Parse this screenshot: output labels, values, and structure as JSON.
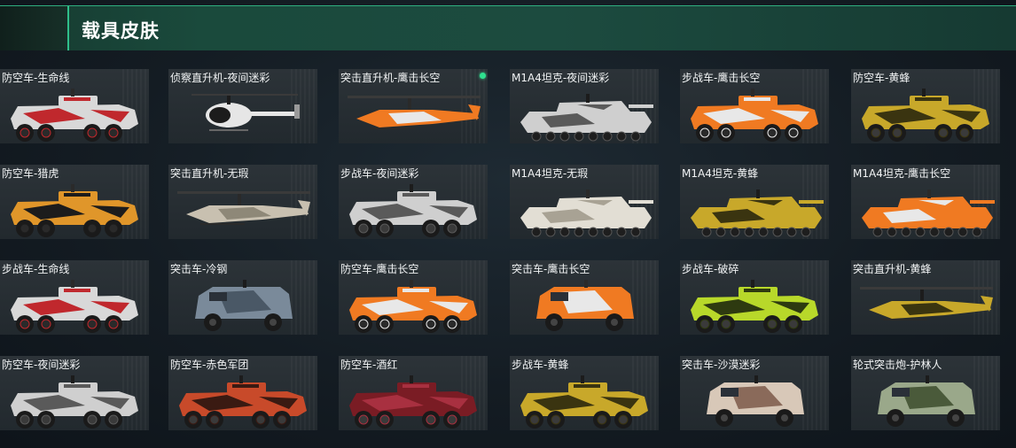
{
  "header": {
    "title": "载具皮肤"
  },
  "colors": {
    "accent": "#2fbf8a",
    "header_bg": "#1a4a3c",
    "card_bg": "#272e33"
  },
  "skins": [
    {
      "label": "防空车-生命线",
      "vehicle": "wheeled",
      "palette": [
        "#d8d8d8",
        "#c0282d",
        "#2a2a2a"
      ]
    },
    {
      "label": "侦察直升机-夜间迷彩",
      "vehicle": "scout-heli",
      "palette": [
        "#e6e6e6",
        "#9a9a9a",
        "#1c1c1c"
      ]
    },
    {
      "label": "突击直升机-鹰击长空",
      "vehicle": "attack-heli",
      "palette": [
        "#f07a22",
        "#e8e8e8",
        "#2a2a2a"
      ],
      "equipped": true
    },
    {
      "label": "M1A4坦克-夜间迷彩",
      "vehicle": "tank",
      "palette": [
        "#cfcfcf",
        "#5a5a5a",
        "#1c1c1c"
      ]
    },
    {
      "label": "步战车-鹰击长空",
      "vehicle": "wheeled",
      "palette": [
        "#f07a22",
        "#e8e8e8",
        "#2a2a2a"
      ]
    },
    {
      "label": "防空车-黄蜂",
      "vehicle": "wheeled",
      "palette": [
        "#c8a82a",
        "#3a3410",
        "#1c1c1c"
      ]
    },
    {
      "label": "防空车-猎虎",
      "vehicle": "wheeled",
      "palette": [
        "#e0962a",
        "#1c1c1c",
        "#2a2a2a"
      ]
    },
    {
      "label": "突击直升机-无瑕",
      "vehicle": "attack-heli",
      "palette": [
        "#c8c0b0",
        "#8e8878",
        "#2a2a2a"
      ]
    },
    {
      "label": "步战车-夜间迷彩",
      "vehicle": "wheeled",
      "palette": [
        "#cfcfcf",
        "#5a5a5a",
        "#1c1c1c"
      ]
    },
    {
      "label": "M1A4坦克-无瑕",
      "vehicle": "tank",
      "palette": [
        "#e2ded4",
        "#a8a294",
        "#2a2a2a"
      ]
    },
    {
      "label": "M1A4坦克-黄蜂",
      "vehicle": "tank",
      "palette": [
        "#c8a82a",
        "#3a3410",
        "#1c1c1c"
      ]
    },
    {
      "label": "M1A4坦克-鹰击长空",
      "vehicle": "tank",
      "palette": [
        "#f07a22",
        "#e8e8e8",
        "#2a2a2a"
      ]
    },
    {
      "label": "步战车-生命线",
      "vehicle": "wheeled",
      "palette": [
        "#d8d8d8",
        "#c0282d",
        "#2a2a2a"
      ]
    },
    {
      "label": "突击车-冷钢",
      "vehicle": "armored-car",
      "palette": [
        "#7a8a9a",
        "#4a5866",
        "#1c1c1c"
      ]
    },
    {
      "label": "防空车-鹰击长空",
      "vehicle": "wheeled",
      "palette": [
        "#f07a22",
        "#e8e8e8",
        "#2a2a2a"
      ]
    },
    {
      "label": "突击车-鹰击长空",
      "vehicle": "armored-car",
      "palette": [
        "#f07a22",
        "#e8e8e8",
        "#2a2a2a"
      ]
    },
    {
      "label": "步战车-破碎",
      "vehicle": "wheeled",
      "palette": [
        "#b8d82a",
        "#2e3a10",
        "#1c1c1c"
      ]
    },
    {
      "label": "突击直升机-黄蜂",
      "vehicle": "attack-heli",
      "palette": [
        "#c8a82a",
        "#3a3410",
        "#1c1c1c"
      ]
    },
    {
      "label": "防空车-夜间迷彩",
      "vehicle": "wheeled",
      "palette": [
        "#cfcfcf",
        "#5a5a5a",
        "#1c1c1c"
      ]
    },
    {
      "label": "防空车-赤色军团",
      "vehicle": "wheeled",
      "palette": [
        "#c84a2a",
        "#3a1a12",
        "#1c1c1c"
      ]
    },
    {
      "label": "防空车-酒红",
      "vehicle": "wheeled",
      "palette": [
        "#7a1c24",
        "#a83040",
        "#1c1c1c"
      ]
    },
    {
      "label": "步战车-黄蜂",
      "vehicle": "wheeled",
      "palette": [
        "#c8a82a",
        "#3a3410",
        "#1c1c1c"
      ]
    },
    {
      "label": "突击车-沙漠迷彩",
      "vehicle": "armored-car",
      "palette": [
        "#d8c8b8",
        "#8a6a5a",
        "#1c1c1c"
      ]
    },
    {
      "label": "轮式突击炮-护林人",
      "vehicle": "armored-car",
      "palette": [
        "#9aa88a",
        "#4a5a3a",
        "#1c1c1c"
      ]
    }
  ]
}
